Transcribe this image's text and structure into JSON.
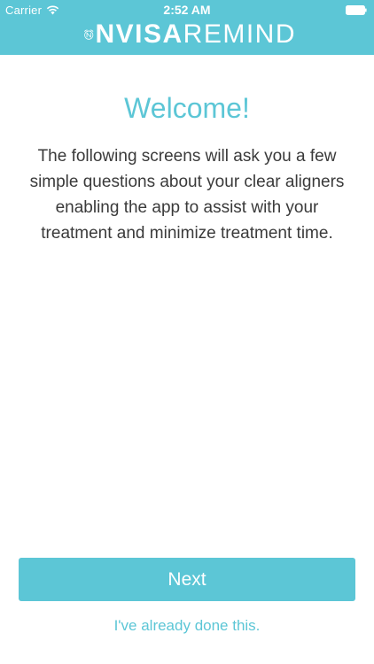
{
  "status_bar": {
    "carrier": "Carrier",
    "time": "2:52 AM",
    "wifi_icon": "wifi-icon",
    "battery_icon": "battery-icon"
  },
  "header": {
    "logo_bold": "NVISA",
    "logo_thin": "REMIND",
    "logo_icon": "alarm-clock-n-logo-icon"
  },
  "main": {
    "title": "Welcome!",
    "body": "The following screens will ask you a few simple questions about your clear aligners enabling the app to assist with your treatment and minimize treatment time."
  },
  "actions": {
    "next_label": "Next",
    "done_label": "I've already done this."
  },
  "colors": {
    "accent": "#5cc6d6",
    "text": "#3a3a3a",
    "background": "#ffffff"
  }
}
